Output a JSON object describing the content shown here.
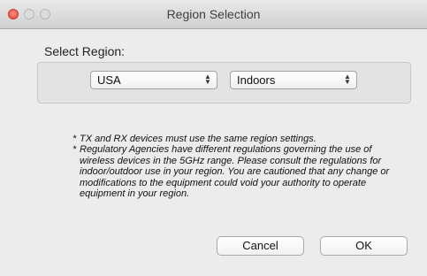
{
  "window": {
    "title": "Region Selection"
  },
  "region": {
    "label": "Select Region:",
    "country_select": {
      "value": "USA",
      "arrow_up": "▲",
      "arrow_down": "▼"
    },
    "location_select": {
      "value": "Indoors",
      "arrow_up": "▲",
      "arrow_down": "▼"
    }
  },
  "notes": [
    {
      "marker": "*",
      "text": "TX and RX devices must use the same region settings."
    },
    {
      "marker": "*",
      "text": "Regulatory Agencies have different regulations governing the use of wireless devices in the 5GHz range. Please consult the regulations for indoor/outdoor use in your region. You are cautioned that any change or modifications to the equipment could void your authority to operate equipment in your region."
    }
  ],
  "buttons": {
    "cancel": "Cancel",
    "ok": "OK"
  }
}
